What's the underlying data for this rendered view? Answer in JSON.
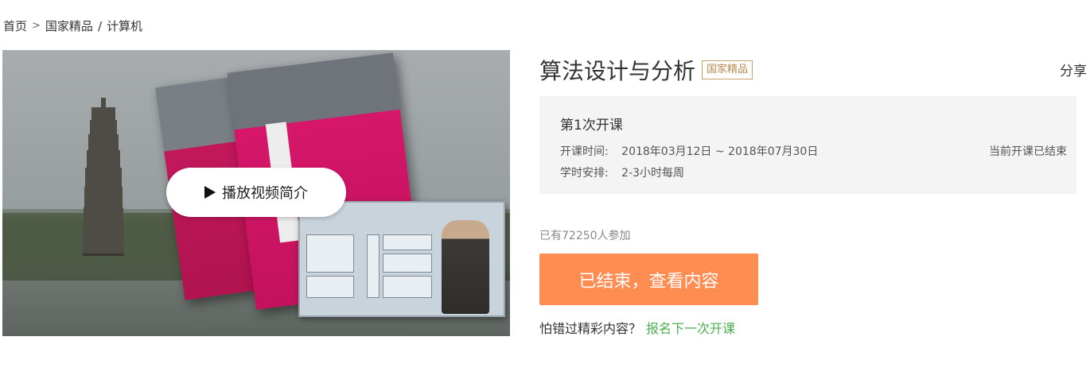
{
  "breadcrumb": {
    "home": "首页",
    "separator": ">",
    "category": "国家精品",
    "slash": "/",
    "subcategory": "计算机"
  },
  "video": {
    "play_label": "播放视频简介",
    "play_icon": "play-icon"
  },
  "course": {
    "title": "算法设计与分析",
    "badge": "国家精品",
    "share_label": "分享"
  },
  "session": {
    "title": "第1次开课",
    "time_key": "开课时间:",
    "time_value": "2018年03月12日 ~ 2018年07月30日",
    "hours_key": "学时安排:",
    "hours_value": "2-3小时每周",
    "status": "当前开课已结束"
  },
  "enrollment": {
    "participants": "已有72250人参加",
    "cta_label": "已结束，查看内容",
    "fear_text": "怕错过精彩内容？",
    "next_label": "报名下一次开课"
  },
  "colors": {
    "cta_bg": "#ff8c50",
    "badge": "#b8894e",
    "next_link": "#4caf50",
    "session_bg": "#f4f4f4"
  }
}
